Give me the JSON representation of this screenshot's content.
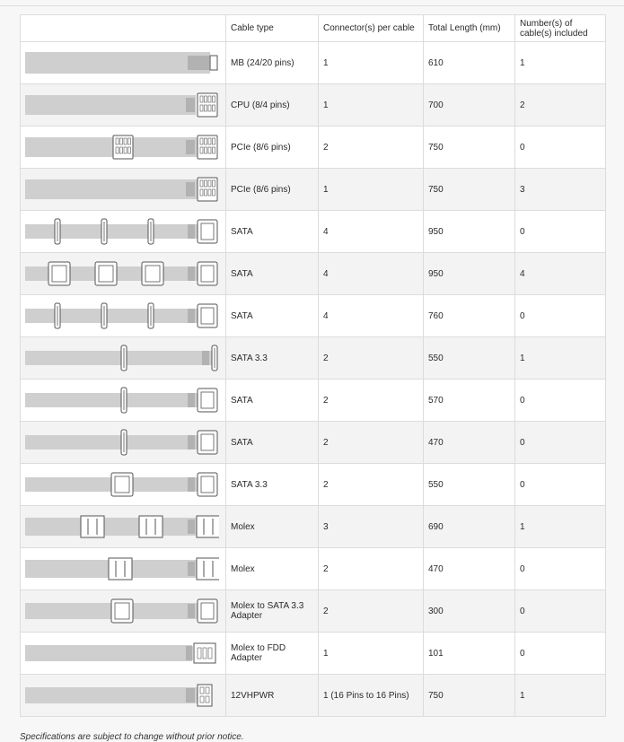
{
  "table": {
    "headers": [
      "",
      "Cable type",
      "Connector(s) per cable",
      "Total Length (mm)",
      "Number(s) of cable(s) included"
    ],
    "rows": [
      {
        "cable_type": "MB (24/20 pins)",
        "connectors": "1",
        "length": "610",
        "included": "1",
        "icon": "mb-cable-icon"
      },
      {
        "cable_type": "CPU (8/4 pins)",
        "connectors": "1",
        "length": "700",
        "included": "2",
        "icon": "cpu-cable-icon"
      },
      {
        "cable_type": "PCIe (8/6 pins)",
        "connectors": "2",
        "length": "750",
        "included": "0",
        "icon": "pcie-dual-cable-icon"
      },
      {
        "cable_type": "PCIe (8/6 pins)",
        "connectors": "1",
        "length": "750",
        "included": "3",
        "icon": "pcie-cable-icon"
      },
      {
        "cable_type": "SATA",
        "connectors": "4",
        "length": "950",
        "included": "0",
        "icon": "sata-slim-cable-icon"
      },
      {
        "cable_type": "SATA",
        "connectors": "4",
        "length": "950",
        "included": "4",
        "icon": "sata-wide-cable-icon"
      },
      {
        "cable_type": "SATA",
        "connectors": "4",
        "length": "760",
        "included": "0",
        "icon": "sata-slim-cable-icon"
      },
      {
        "cable_type": "SATA 3.3",
        "connectors": "2",
        "length": "550",
        "included": "1",
        "icon": "sata33-slim-cable-icon"
      },
      {
        "cable_type": "SATA",
        "connectors": "2",
        "length": "570",
        "included": "0",
        "icon": "sata-2-cable-icon"
      },
      {
        "cable_type": "SATA",
        "connectors": "2",
        "length": "470",
        "included": "0",
        "icon": "sata-2-slim-cable-icon"
      },
      {
        "cable_type": "SATA 3.3",
        "connectors": "2",
        "length": "550",
        "included": "0",
        "icon": "sata33-cable-icon"
      },
      {
        "cable_type": "Molex",
        "connectors": "3",
        "length": "690",
        "included": "1",
        "icon": "molex-3-cable-icon"
      },
      {
        "cable_type": "Molex",
        "connectors": "2",
        "length": "470",
        "included": "0",
        "icon": "molex-2-cable-icon"
      },
      {
        "cable_type": "Molex to SATA 3.3 Adapter",
        "connectors": "2",
        "length": "300",
        "included": "0",
        "icon": "molex-sata-adapter-icon"
      },
      {
        "cable_type": "Molex to FDD Adapter",
        "connectors": "1",
        "length": "101",
        "included": "0",
        "icon": "molex-fdd-adapter-icon"
      },
      {
        "cable_type": "12VHPWR",
        "connectors": "1 (16 Pins to 16 Pins)",
        "length": "750",
        "included": "1",
        "icon": "12vhpwr-cable-icon"
      }
    ]
  },
  "footnote": "Specifications are subject to change without prior notice.",
  "colors": {
    "cable_gray": "#cfcfcf",
    "connector_outline": "#555555",
    "border": "#dcdcdc",
    "row_alt": "#f3f3f3"
  }
}
